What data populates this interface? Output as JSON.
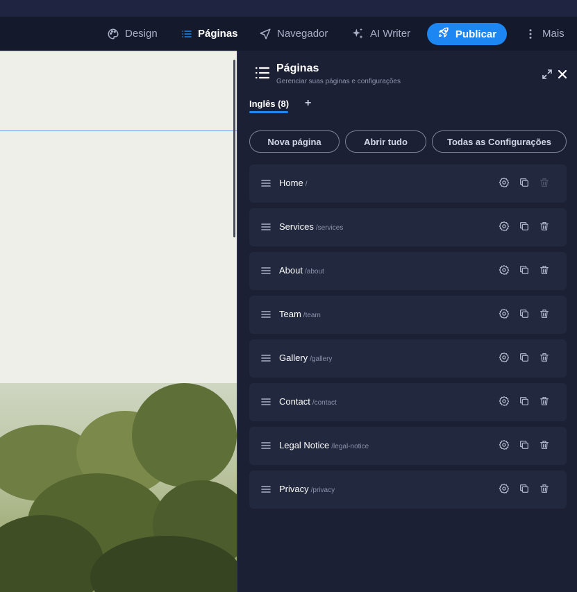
{
  "toolbar": {
    "design_label": "Design",
    "pages_label": "Páginas",
    "navigator_label": "Navegador",
    "ai_writer_label": "AI Writer",
    "publish_label": "Publicar",
    "more_label": "Mais"
  },
  "panel": {
    "title": "Páginas",
    "subtitle": "Gerenciar suas páginas e configurações",
    "tab_label": "Inglês (8)",
    "add_tab_label": "+",
    "buttons": {
      "new_page": "Nova página",
      "open_all": "Abrir tudo",
      "all_settings": "Todas as Configurações"
    },
    "pages": [
      {
        "name": "Home",
        "slug": "/",
        "delete_enabled": false
      },
      {
        "name": "Services",
        "slug": "/services",
        "delete_enabled": true
      },
      {
        "name": "About",
        "slug": "/about",
        "delete_enabled": true
      },
      {
        "name": "Team",
        "slug": "/team",
        "delete_enabled": true
      },
      {
        "name": "Gallery",
        "slug": "/gallery",
        "delete_enabled": true
      },
      {
        "name": "Contact",
        "slug": "/contact",
        "delete_enabled": true
      },
      {
        "name": "Legal Notice",
        "slug": "/legal-notice",
        "delete_enabled": true
      },
      {
        "name": "Privacy",
        "slug": "/privacy",
        "delete_enabled": true
      }
    ]
  },
  "colors": {
    "accent": "#1c86f2",
    "panel_bg": "#1b2035",
    "row_bg": "#22283e",
    "toolbar_bg": "#141a2c",
    "canvas_bg": "#eeefe9"
  },
  "icons": {
    "design": "palette-icon",
    "pages": "list-icon",
    "navigator": "navigation-arrow-icon",
    "ai_writer": "sparkles-icon",
    "publish": "rocket-icon",
    "more": "vertical-dots-icon",
    "row_drag": "drag-handle-icon",
    "row_settings": "gear-icon",
    "row_duplicate": "copy-icon",
    "row_delete": "trash-icon"
  }
}
